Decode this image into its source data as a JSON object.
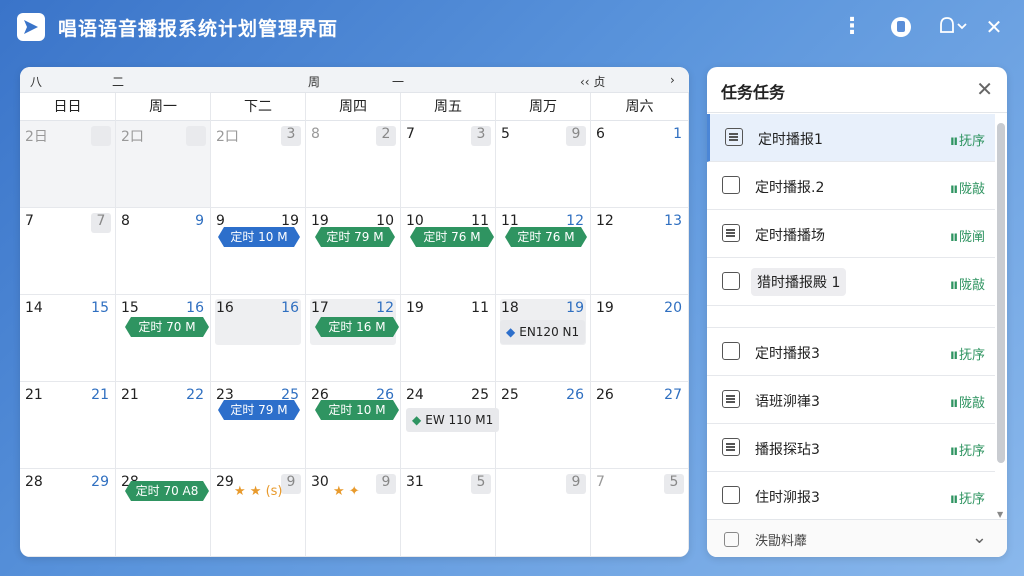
{
  "app": {
    "title": "唱语语音播报系统计划管理界面"
  },
  "window_controls": {
    "more_icon": "⋮",
    "bell_icon": "♫",
    "close_icon": "✕"
  },
  "calendar": {
    "toolbar": [
      "八",
      "二",
      "周",
      "一",
      "‹‹ 贞",
      "›"
    ],
    "weekdays": [
      "日日",
      "周一",
      "下二",
      "周四",
      "周五",
      "周万",
      "周六"
    ],
    "weeks": [
      [
        {
          "left": "2日",
          "right": "",
          "dim": true,
          "left_grey": true,
          "right_grey": true
        },
        {
          "left": "2口",
          "right": "",
          "dim": true,
          "left_grey": true,
          "right_grey": true
        },
        {
          "left": "2口",
          "right": "3",
          "dim": false,
          "left_grey": true,
          "right_grey": true
        },
        {
          "left": "8",
          "right": "2",
          "dim": false,
          "left_grey": true,
          "right_grey": true
        },
        {
          "left": "7",
          "right": "3",
          "dim": false,
          "left_grey": false,
          "right_grey": true
        },
        {
          "left": "5",
          "right": "9",
          "dim": false,
          "left_grey": false,
          "right_grey": true
        },
        {
          "left": "6",
          "right": "1",
          "dim": false,
          "left_grey": false,
          "right_grey": false
        }
      ],
      [
        {
          "left": "7",
          "right": "7",
          "right_grey": true
        },
        {
          "left": "8",
          "right": "9"
        },
        {
          "left": "9",
          "right": "19",
          "right_dark": true
        },
        {
          "left": "19",
          "right": "10",
          "right_dark": true
        },
        {
          "left": "10",
          "right": "11",
          "right_dark": true
        },
        {
          "left": "11",
          "right": "12"
        },
        {
          "left": "12",
          "right": "13"
        }
      ],
      [
        {
          "left": "14",
          "right": "15"
        },
        {
          "left": "15",
          "right": "16"
        },
        {
          "left": "16",
          "right": "16",
          "dim_inner": true
        },
        {
          "left": "17",
          "right": "12",
          "dim_inner": true
        },
        {
          "left": "19",
          "right": "11",
          "right_dark": true
        },
        {
          "left": "18",
          "right": "19",
          "dim_inner": true
        },
        {
          "left": "19",
          "right": "20"
        }
      ],
      [
        {
          "left": "21",
          "right": "21"
        },
        {
          "left": "21",
          "right": "22"
        },
        {
          "left": "23",
          "right": "25"
        },
        {
          "left": "26",
          "right": "26"
        },
        {
          "left": "24",
          "right": "25",
          "right_dark": true
        },
        {
          "left": "25",
          "right": "26"
        },
        {
          "left": "26",
          "right": "27"
        }
      ],
      [
        {
          "left": "28",
          "right": "29"
        },
        {
          "left": "28",
          "right": ""
        },
        {
          "left": "29",
          "right": "9",
          "right_grey": true
        },
        {
          "left": "30",
          "right": "9",
          "right_grey": true
        },
        {
          "left": "31",
          "right": "5",
          "right_grey": true
        },
        {
          "left": "",
          "right": "9",
          "right_grey": true
        },
        {
          "left": "7",
          "right": "5",
          "left_grey": true,
          "right_grey": true
        }
      ]
    ],
    "events": [
      {
        "label": "定时 10 M",
        "color": "blue"
      },
      {
        "label": "定时 79 M",
        "color": "green"
      },
      {
        "label": "定时 76 M",
        "color": "green"
      },
      {
        "label": "定时 76 M",
        "color": "green"
      },
      {
        "label": "定时 70 M",
        "color": "green"
      },
      {
        "label": "定时 16 M",
        "color": "green"
      },
      {
        "label": "定时 79 M",
        "color": "blue"
      },
      {
        "label": "定时 10 M",
        "color": "green"
      },
      {
        "label": "定时 70 A8",
        "color": "green"
      }
    ],
    "chips": [
      {
        "marker": "◆",
        "label": "EN120 N1",
        "marker_color": "#2d6fcb"
      },
      {
        "marker": "◆",
        "label": "EW 110 M1",
        "marker_color": "#2f9461"
      }
    ],
    "stars": [
      {
        "text": "★ ★ (s)"
      },
      {
        "text": "★ ✦"
      }
    ]
  },
  "tasks": {
    "title": "任务任务",
    "close_icon": "✕",
    "items": [
      {
        "name": "定时播报1",
        "status": "抚序",
        "icon": "list",
        "selected": true,
        "boxed": false
      },
      {
        "name": "定时播报.2",
        "status": "陇敲",
        "icon": "checkbox",
        "selected": false,
        "boxed": false
      },
      {
        "name": "定时播播场",
        "status": "陇阐",
        "icon": "list",
        "selected": false,
        "boxed": false
      },
      {
        "name": "猎时播报殿 1",
        "status": "陇敲",
        "icon": "checkbox",
        "selected": false,
        "boxed": true
      },
      {
        "name": "定时播报3",
        "status": "抚序",
        "icon": "checkbox",
        "selected": false,
        "boxed": false
      },
      {
        "name": "语班泖嵂3",
        "status": "陇敲",
        "icon": "list",
        "selected": false,
        "boxed": false
      },
      {
        "name": "播报探玷3",
        "status": "抚序",
        "icon": "list",
        "selected": false,
        "boxed": false
      },
      {
        "name": "住时泖报3",
        "status": "抚序",
        "icon": "checkbox",
        "selected": false,
        "boxed": false
      }
    ],
    "status_wave": "ıı",
    "footer_label": "泆勖料蘼",
    "footer_chevron": "⌄"
  },
  "colors": {
    "accent_blue": "#2d6fcb",
    "accent_green": "#2f9461"
  }
}
